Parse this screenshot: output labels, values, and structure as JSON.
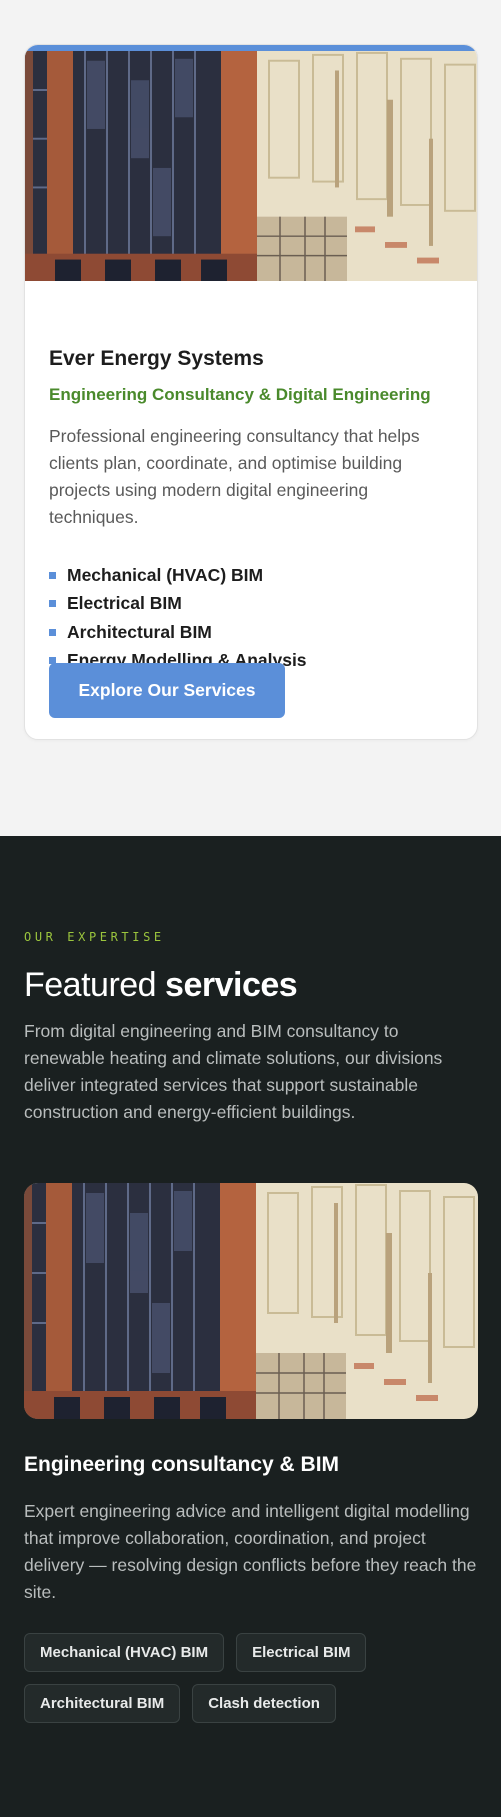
{
  "card": {
    "title": "Ever Energy Systems",
    "subtitle": "Engineering Consultancy & Digital Engineering",
    "description": "Professional engineering consultancy that helps clients plan, coordinate, and optimise building projects using modern digital engineering techniques.",
    "services": [
      "Mechanical (HVAC) BIM",
      "Electrical BIM",
      "Architectural BIM",
      "Energy Modelling & Analysis"
    ],
    "cta_label": "Explore Our Services",
    "accent_color": "#5b8fd9",
    "subtitle_color": "#4a8a2c"
  },
  "expertise": {
    "eyebrow": "OUR EXPERTISE",
    "heading_regular": "Featured",
    "heading_bold": "services",
    "intro": "From digital engineering and BIM consultancy to renewable heating and climate solutions, our divisions deliver integrated services that support sustainable construction and energy-efficient buildings.",
    "service": {
      "title": "Engineering consultancy & BIM",
      "description": "Expert engineering advice and intelligent digital modelling that improve collaboration, coordination, and project delivery — resolving design conflicts before they reach the site.",
      "tags": [
        "Mechanical (HVAC) BIM",
        "Electrical BIM",
        "Architectural BIM",
        "Clash detection"
      ]
    },
    "background_color": "#1a2020",
    "eyebrow_color": "#9bc53d"
  }
}
